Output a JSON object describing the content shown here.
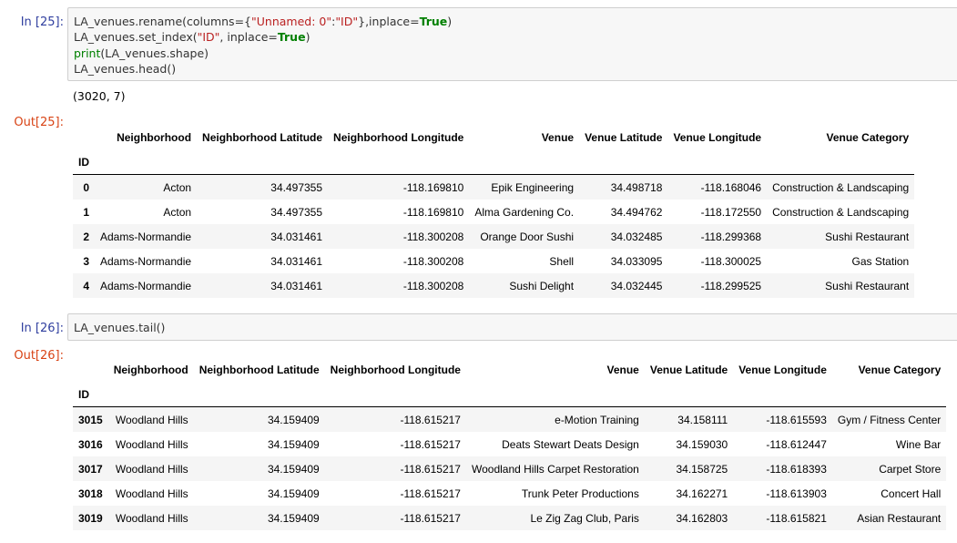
{
  "cells": {
    "c25": {
      "in_prompt": "In [25]:",
      "code_lines": [
        [
          [
            "t",
            "LA_venues.rename(columns={"
          ],
          [
            "st",
            "\"Unnamed: 0\""
          ],
          [
            "t",
            ":"
          ],
          [
            "st",
            "\"ID\""
          ],
          [
            "t",
            "},inplace="
          ],
          [
            "kw",
            "True"
          ],
          [
            "t",
            ")"
          ]
        ],
        [
          [
            "t",
            "LA_venues.set_index("
          ],
          [
            "st",
            "\"ID\""
          ],
          [
            "t",
            ", inplace="
          ],
          [
            "kw",
            "True"
          ],
          [
            "t",
            ")"
          ]
        ],
        [
          [
            "bi",
            "print"
          ],
          [
            "t",
            "(LA_venues.shape)"
          ]
        ],
        [
          [
            "t",
            "LA_venues.head()"
          ]
        ]
      ],
      "stream_output": "(3020, 7)",
      "out_prompt": "Out[25]:",
      "table": {
        "columns": [
          "Neighborhood",
          "Neighborhood Latitude",
          "Neighborhood Longitude",
          "Venue",
          "Venue Latitude",
          "Venue Longitude",
          "Venue Category"
        ],
        "index_name": "ID",
        "rows": [
          {
            "idx": "0",
            "cells": [
              "Acton",
              "34.497355",
              "-118.169810",
              "Epik Engineering",
              "34.498718",
              "-118.168046",
              "Construction & Landscaping"
            ]
          },
          {
            "idx": "1",
            "cells": [
              "Acton",
              "34.497355",
              "-118.169810",
              "Alma Gardening Co.",
              "34.494762",
              "-118.172550",
              "Construction & Landscaping"
            ]
          },
          {
            "idx": "2",
            "cells": [
              "Adams-Normandie",
              "34.031461",
              "-118.300208",
              "Orange Door Sushi",
              "34.032485",
              "-118.299368",
              "Sushi Restaurant"
            ]
          },
          {
            "idx": "3",
            "cells": [
              "Adams-Normandie",
              "34.031461",
              "-118.300208",
              "Shell",
              "34.033095",
              "-118.300025",
              "Gas Station"
            ]
          },
          {
            "idx": "4",
            "cells": [
              "Adams-Normandie",
              "34.031461",
              "-118.300208",
              "Sushi Delight",
              "34.032445",
              "-118.299525",
              "Sushi Restaurant"
            ]
          }
        ]
      }
    },
    "c26": {
      "in_prompt": "In [26]:",
      "code_lines": [
        [
          [
            "t",
            "LA_venues.tail()"
          ]
        ]
      ],
      "out_prompt": "Out[26]:",
      "table": {
        "columns": [
          "Neighborhood",
          "Neighborhood Latitude",
          "Neighborhood Longitude",
          "Venue",
          "Venue Latitude",
          "Venue Longitude",
          "Venue Category"
        ],
        "index_name": "ID",
        "rows": [
          {
            "idx": "3015",
            "cells": [
              "Woodland Hills",
              "34.159409",
              "-118.615217",
              "e-Motion Training",
              "34.158111",
              "-118.615593",
              "Gym / Fitness Center"
            ]
          },
          {
            "idx": "3016",
            "cells": [
              "Woodland Hills",
              "34.159409",
              "-118.615217",
              "Deats Stewart Deats Design",
              "34.159030",
              "-118.612447",
              "Wine Bar"
            ]
          },
          {
            "idx": "3017",
            "cells": [
              "Woodland Hills",
              "34.159409",
              "-118.615217",
              "Woodland Hills Carpet Restoration",
              "34.158725",
              "-118.618393",
              "Carpet Store"
            ]
          },
          {
            "idx": "3018",
            "cells": [
              "Woodland Hills",
              "34.159409",
              "-118.615217",
              "Trunk Peter Productions",
              "34.162271",
              "-118.613903",
              "Concert Hall"
            ]
          },
          {
            "idx": "3019",
            "cells": [
              "Woodland Hills",
              "34.159409",
              "-118.615217",
              "Le Zig Zag Club, Paris",
              "34.162803",
              "-118.615821",
              "Asian Restaurant"
            ]
          }
        ]
      }
    }
  }
}
